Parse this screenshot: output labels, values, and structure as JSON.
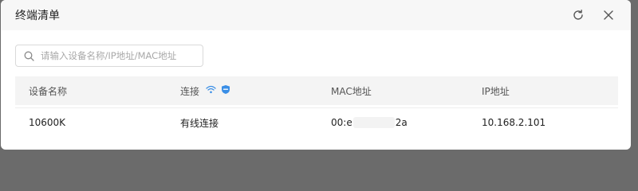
{
  "dialog": {
    "title": "终端清单"
  },
  "icons": {
    "refresh": "refresh-icon",
    "close": "close-icon",
    "search": "search-icon",
    "wifi": "wifi-icon",
    "shield": "shield-icon"
  },
  "colors": {
    "accent": "#3a8ee6",
    "header_bg": "#f7f7f7",
    "table_header_bg": "#f4f4f4"
  },
  "search": {
    "placeholder": "请输入设备名称/IP地址/MAC地址",
    "value": ""
  },
  "table": {
    "columns": [
      "设备名称",
      "连接",
      "MAC地址",
      "IP地址"
    ],
    "rows": [
      {
        "device_name": "10600K",
        "connection": "有线连接",
        "mac_prefix": "00:e",
        "mac_suffix": "2a",
        "ip": "10.168.2.101"
      }
    ]
  }
}
